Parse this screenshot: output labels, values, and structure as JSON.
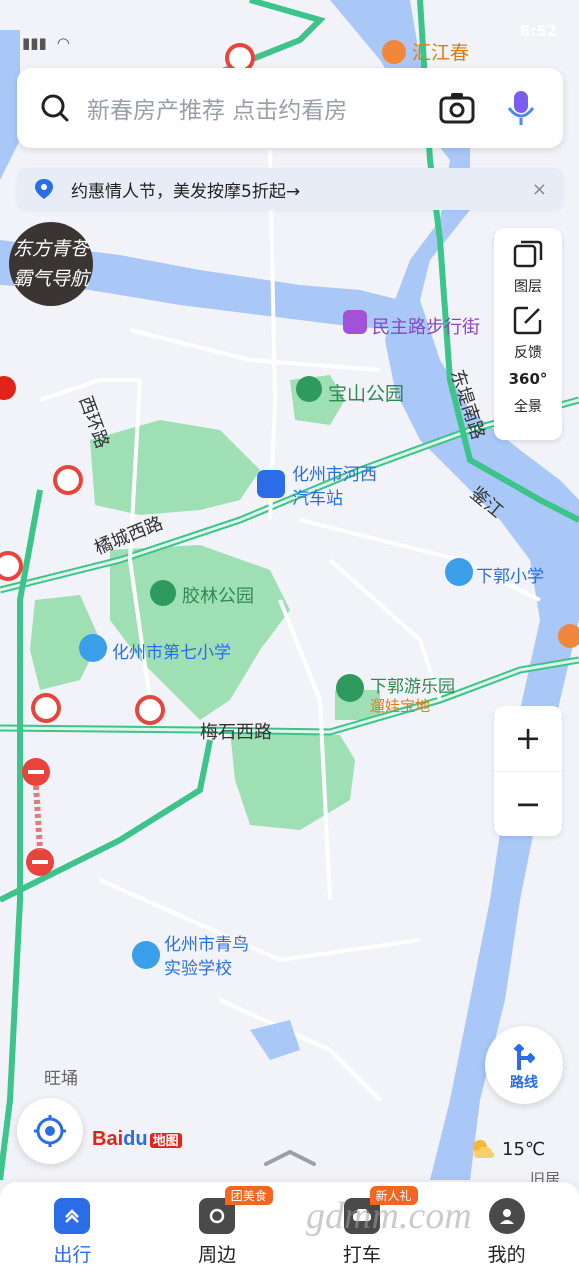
{
  "status_bar": {
    "time": "8:52"
  },
  "search": {
    "placeholder": "新春房产推荐 点击约看房"
  },
  "promo": {
    "text": "约惠情人节，美发按摩5折起→",
    "close": "×"
  },
  "avatar": {
    "line1": "东方青苍",
    "line2": "霸气导航"
  },
  "side_panel": {
    "layers": "图层",
    "feedback": "反馈",
    "panorama_badge": "360°",
    "panorama": "全景"
  },
  "zoom": {
    "plus": "+",
    "minus": "−"
  },
  "map_labels": {
    "huijiangchun": "汇江春",
    "minzhu": "民主路步行街",
    "baoshan": "宝山公园",
    "xihuan": "西环路",
    "dongdi": "东堤南路",
    "bus_station": "化州市河西\n汽车站",
    "jujiang": "鉴江",
    "juchengxi": "橘城西路",
    "jiaolin": "胶林公园",
    "xiaguo_school": "下郭小学",
    "seventh_school": "化州市第七小学",
    "xiaguo_park": "下郭游乐园",
    "xiaguo_sub": "遛娃宝地",
    "meishi": "梅石西路",
    "qingniao": "化州市青鸟\n实验学校",
    "wangyong": "旺埇",
    "jiuju": "旧居"
  },
  "route_button": {
    "label": "路线"
  },
  "weather": {
    "temp": "15℃"
  },
  "logo": {
    "bai": "Bai",
    "du": "du",
    "map": "地图"
  },
  "bottom_nav": {
    "tabs": [
      {
        "label": "出行",
        "active": true
      },
      {
        "label": "周边",
        "badge": "团美食"
      },
      {
        "label": "打车",
        "badge": "新人礼"
      },
      {
        "label": "我的"
      }
    ]
  },
  "watermark": "gdmm.com",
  "colors": {
    "accent": "#2a6de6",
    "river": "#a9c8f7",
    "park": "#9fdfb4",
    "road_green": "#3cc48a",
    "orange": "#f26522"
  }
}
